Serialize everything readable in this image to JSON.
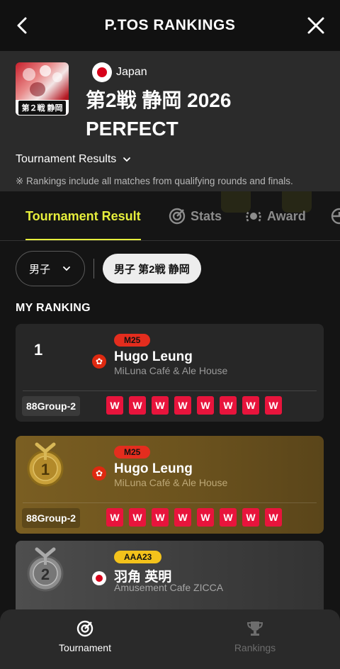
{
  "topbar": {
    "title": "P.TOS RANKINGS",
    "back_icon": "chevron-left-icon",
    "close_icon": "close-icon"
  },
  "event": {
    "thumbnail_label": "第２戦 静岡",
    "country": "Japan",
    "name_line1": "第2戦 静岡 2026",
    "name_line2": "PERFECT",
    "results_toggle": "Tournament Results",
    "note": "※ Rankings include all matches from qualifying rounds and finals."
  },
  "tabs": [
    {
      "label": "Tournament Result",
      "active": true
    },
    {
      "label": "Stats",
      "icon": "target-icon"
    },
    {
      "label": "Award",
      "icon": "laurel-icon"
    }
  ],
  "filters": {
    "category": "男子",
    "round": "男子 第2戦 静岡"
  },
  "section_label": "MY RANKING",
  "rankings": [
    {
      "rank": "1",
      "class": "M25",
      "class_color": "#e42d1e",
      "flag": "hong-kong",
      "name": "Hugo Leung",
      "shop": "MiLuna Café & Ale House",
      "group": "88Group-2",
      "results": [
        "W",
        "W",
        "W",
        "W",
        "W",
        "W",
        "W",
        "W"
      ]
    },
    {
      "rank": "1",
      "medal": "gold-medal-icon",
      "class": "M25",
      "class_color": "#e42d1e",
      "flag": "hong-kong",
      "name": "Hugo Leung",
      "shop": "MiLuna Café & Ale House",
      "group": "88Group-2",
      "results": [
        "W",
        "W",
        "W",
        "W",
        "W",
        "W",
        "W",
        "W"
      ]
    },
    {
      "rank": "2",
      "medal": "silver-medal-icon",
      "class": "AAA23",
      "class_color": "#f3c21b",
      "flag": "japan",
      "name": "羽角 英明",
      "shop": "Amusement Cafe ZICCA"
    }
  ],
  "bottomnav": [
    {
      "label": "Tournament",
      "icon": "target-icon",
      "active": true
    },
    {
      "label": "Rankings",
      "icon": "trophy-icon",
      "active": false
    }
  ]
}
